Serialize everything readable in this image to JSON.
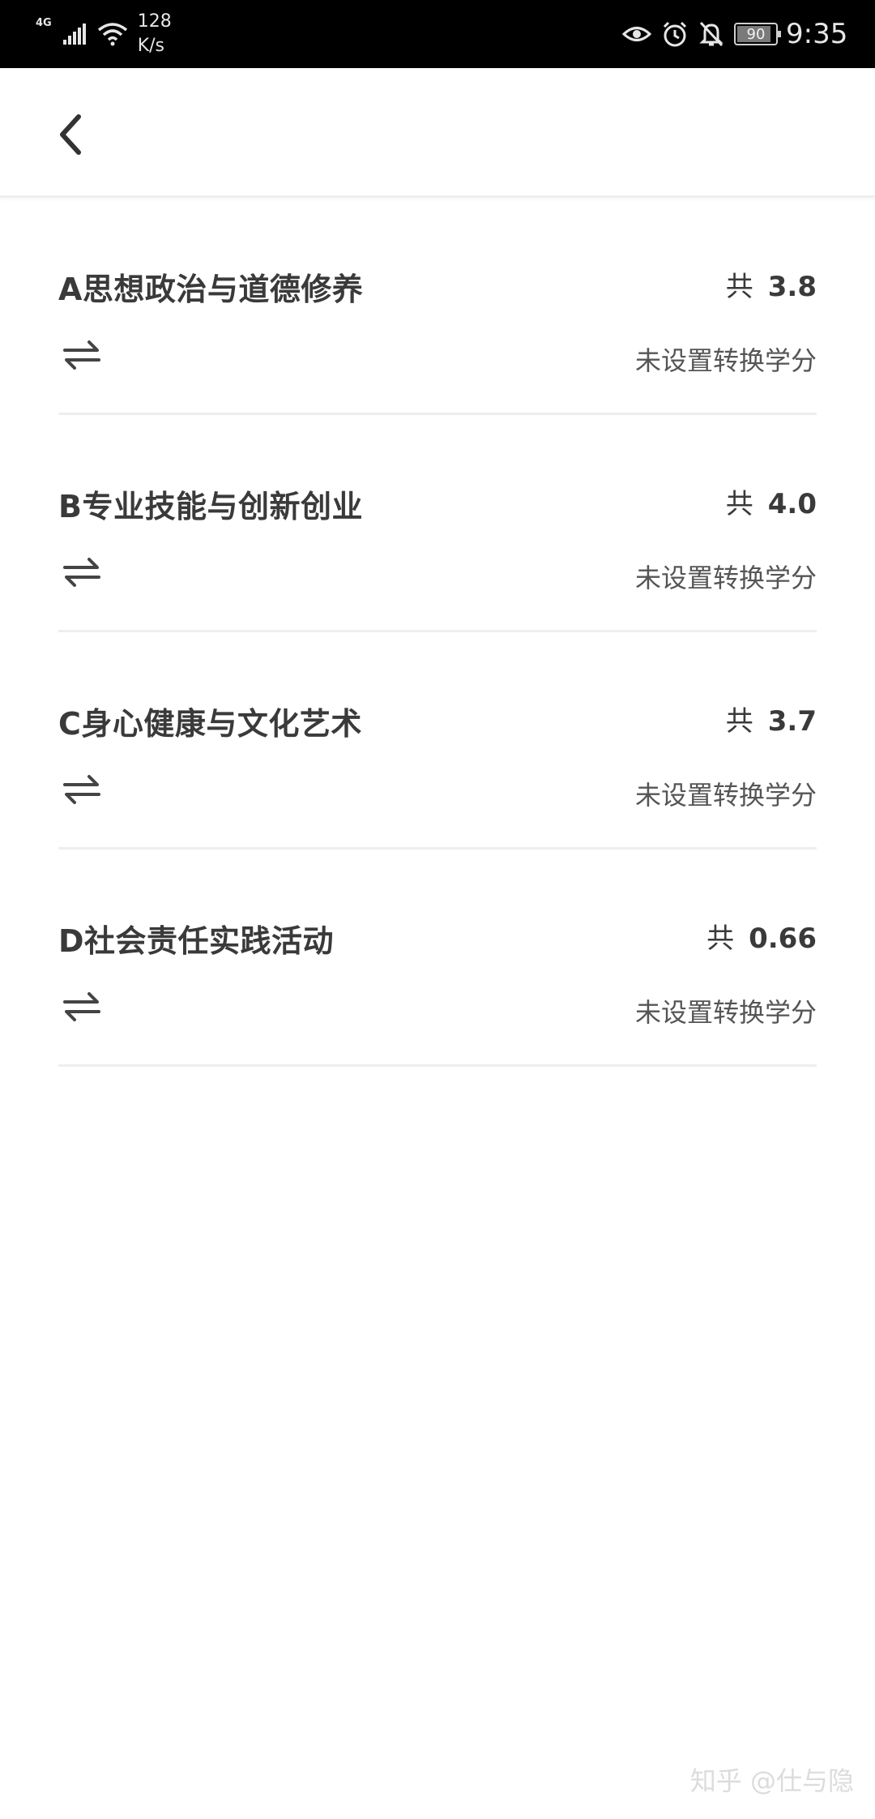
{
  "status_bar": {
    "network_type": "4G",
    "speed_value": "128",
    "speed_unit": "K/s",
    "battery_level": "90",
    "battery_percent": 90,
    "time": "9:35",
    "icons": [
      "signal-icon",
      "wifi-icon",
      "eye-icon",
      "alarm-icon",
      "bell-off-icon",
      "battery-icon"
    ]
  },
  "header": {
    "back_icon": "chevron-left-icon"
  },
  "items": [
    {
      "title": "A思想政治与道德修养",
      "total_prefix": "共",
      "total": "3.8",
      "status": "未设置转换学分"
    },
    {
      "title": "B专业技能与创新创业",
      "total_prefix": "共",
      "total": "4.0",
      "status": "未设置转换学分"
    },
    {
      "title": "C身心健康与文化艺术",
      "total_prefix": "共",
      "total": "3.7",
      "status": "未设置转换学分"
    },
    {
      "title": "D社会责任实践活动",
      "total_prefix": "共",
      "total": "0.66",
      "status": "未设置转换学分"
    }
  ],
  "watermark": "知乎 @仕与隐",
  "colors": {
    "status_bar_bg": "#000000",
    "text_primary": "#3a3a3a",
    "text_secondary": "#555555",
    "divider": "#eeeeee"
  }
}
